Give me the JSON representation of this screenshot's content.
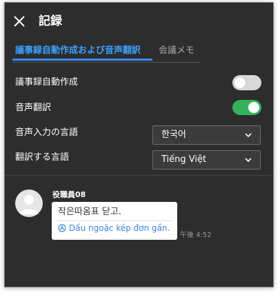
{
  "header": {
    "title": "記録"
  },
  "tabs": [
    {
      "label": "議事録自動作成および音声翻訳",
      "active": true
    },
    {
      "label": "会議メモ",
      "active": false
    }
  ],
  "settings": {
    "auto_minutes": {
      "label": "議事録自動作成",
      "enabled": false
    },
    "voice_translation": {
      "label": "音声翻訳",
      "enabled": true
    },
    "input_language": {
      "label": "音声入力の言語",
      "value": "한국어"
    },
    "translation_language": {
      "label": "翻訳する言語",
      "value": "Tiếng Việt"
    }
  },
  "message": {
    "sender": "役職員08",
    "original": "작은따옴표 닫고.",
    "translation": "Dấu ngoặc kép đơn gần.",
    "time": "午後 4:52"
  },
  "colors": {
    "panel_bg": "#2d2d2d",
    "accent_blue": "#2f8fff",
    "toggle_on": "#33b25b",
    "toggle_off": "#d8d8d8",
    "translation_text": "#3a86d8"
  },
  "icons": {
    "close": "close-icon",
    "chevron": "chevron-down-icon",
    "translate": "translate-icon",
    "avatar": "user-avatar-icon"
  }
}
